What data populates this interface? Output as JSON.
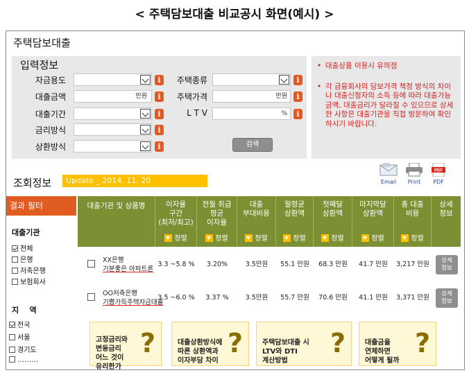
{
  "page_title": "< 주택담보대출 비교공시 화면(예시) >",
  "app_title": "주택담보대출",
  "input_section": {
    "title": "입력정보",
    "fields_left": [
      {
        "label": "자금용도",
        "type": "select",
        "value": ""
      },
      {
        "label": "대출금액",
        "type": "text",
        "unit": "만원"
      },
      {
        "label": "대출기간",
        "type": "select",
        "value": ""
      },
      {
        "label": "금리방식",
        "type": "select",
        "value": ""
      },
      {
        "label": "상환방식",
        "type": "select",
        "value": ""
      }
    ],
    "fields_right": [
      {
        "label": "주택종류",
        "type": "select",
        "value": ""
      },
      {
        "label": "주택가격",
        "type": "text",
        "unit": "만원"
      },
      {
        "label": "L T V",
        "type": "text",
        "unit": "%"
      }
    ],
    "info_icon": "i",
    "search_button": "검색"
  },
  "notice": {
    "items": [
      "대출상품 이용시 유의점",
      "각 금융회사의 담보가격 책정 방식의 차이나 대출신청자의 소득 등에 따라 대출가능금액, 대출금리가 달라질 수 있으므로 상세한 사항은 대출기관을 직접 방문하여 확인하시기 바랍니다."
    ],
    "color": "#d81e1e"
  },
  "exports": [
    {
      "label": "Email",
      "icon": "email-icon"
    },
    {
      "label": "Print",
      "icon": "printer-icon"
    },
    {
      "label": "PDF",
      "icon": "pdf-icon"
    }
  ],
  "results": {
    "title": "조회정보",
    "update_label": "Update _ 2014. 11. 20",
    "filter": {
      "header": "결과 필터",
      "groups": [
        {
          "title": "대출기관",
          "options": [
            {
              "label": "전체",
              "checked": true
            },
            {
              "label": "은행",
              "checked": false
            },
            {
              "label": "저축은행",
              "checked": false
            },
            {
              "label": "보험회사",
              "checked": false
            }
          ]
        },
        {
          "title": "지    역",
          "options": [
            {
              "label": "전국",
              "checked": true
            },
            {
              "label": "서울",
              "checked": false
            },
            {
              "label": "경기도",
              "checked": false
            },
            {
              "label": "………",
              "checked": false
            }
          ]
        }
      ]
    },
    "columns": [
      {
        "label": "대출기관 및 상품명",
        "sortable": false
      },
      {
        "label": "이자율\n구간\n(최저/최고)",
        "sortable": true
      },
      {
        "label": "전월 취급\n평균\n이자율",
        "sortable": true
      },
      {
        "label": "대출\n부대비용",
        "sortable": true
      },
      {
        "label": "월평균\n상환액",
        "sortable": true
      },
      {
        "label": "첫째달\n상환액",
        "sortable": true
      },
      {
        "label": "마지막달\n상환액",
        "sortable": true
      },
      {
        "label": "총 대출\n비용",
        "sortable": true
      },
      {
        "label": "상세\n정보",
        "sortable": false
      }
    ],
    "sort_label": "정렬",
    "rows": [
      {
        "bank": "XX은행",
        "product": "기분좋은 아파트론",
        "rate_range": "3.3 ~5.8 %",
        "avg_rate": "3.20%",
        "extra_cost": "3.5만원",
        "monthly": "55.1 만원",
        "first_month": "68.3 만원",
        "last_month": "41.7 만원",
        "total_cost": "3,217 만원",
        "detail": "상세\n정보"
      },
      {
        "bank": "OO저축은행",
        "product": "기쁨가득주택자금대출",
        "rate_range": "3.5 ~6.0 %",
        "avg_rate": "3.37 %",
        "extra_cost": "3.5만원",
        "monthly": "55.7 만원",
        "first_month": "70.6 만원",
        "last_month": "41.1 만원",
        "total_cost": "3,371 만원",
        "detail": "상세\n정보"
      }
    ]
  },
  "faq": [
    {
      "text": "고정금리와\n변동금리\n어느 것이\n유리한가",
      "mark": "?"
    },
    {
      "text": "대출상환방식에\n따른 상환액과\n이자부담 차이",
      "mark": "?"
    },
    {
      "text": "주택담보대출 시\nLTV와 DTI\n계산방법",
      "mark": "?"
    },
    {
      "text": "대출금을\n연체하면\n어떻게 될까",
      "mark": "?"
    }
  ],
  "colors": {
    "accent_orange": "#e15c20",
    "header_olive": "#7d8f33",
    "update_yellow": "#ffc000",
    "panel_gray": "#e8e8e8"
  }
}
